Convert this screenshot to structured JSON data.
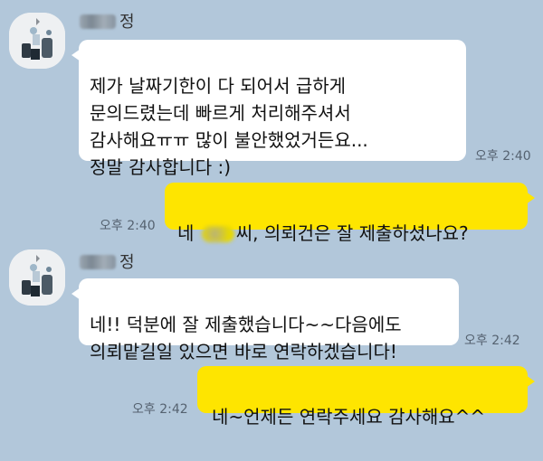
{
  "messages": [
    {
      "sender": "정",
      "text": "제가 날짜기한이 다 되어서 급하게\n문의드렸는데 빠르게 처리해주셔서\n감사해요ㅠㅠ 많이 불안했었거든요...\n정말 감사합니다 :)",
      "time": "오후 2:40"
    },
    {
      "text_before": "네 ",
      "text_after": "씨, 의뢰건은 잘 제출하셨나요?",
      "time": "오후 2:40"
    },
    {
      "sender": "정",
      "text": "네!! 덕분에 잘 제출했습니다~~다음에도\n의뢰맡길일 있으면 바로 연락하겠습니다!",
      "time": "오후 2:42"
    },
    {
      "text": "네~언제든 연락주세요 감사해요^^",
      "time": "오후 2:42"
    }
  ],
  "colors": {
    "background": "#b2c7da",
    "incoming_bubble": "#ffffff",
    "outgoing_bubble": "#fee500"
  }
}
